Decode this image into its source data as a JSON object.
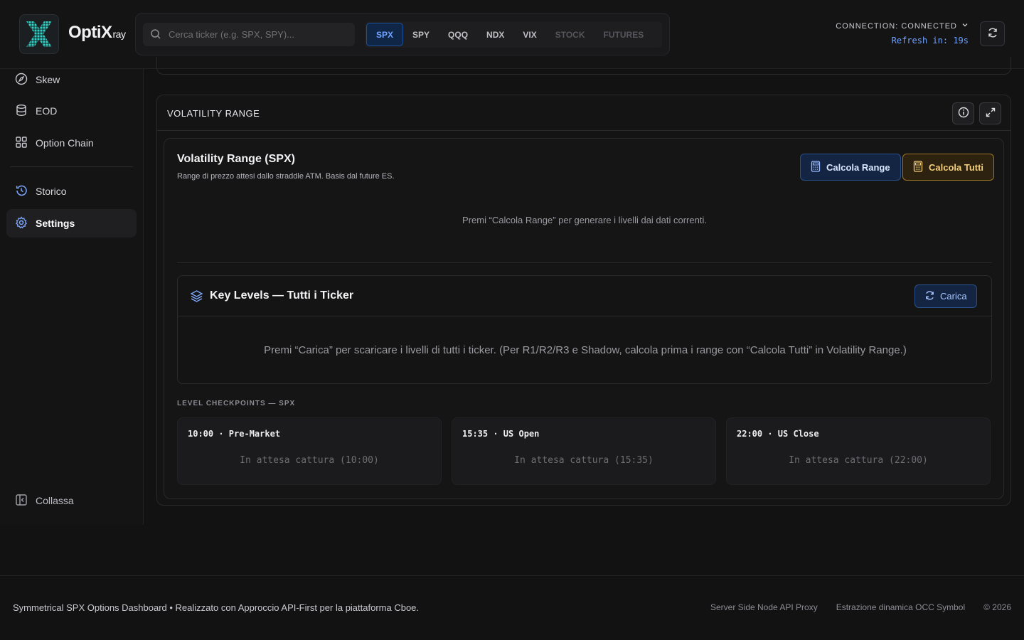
{
  "app": {
    "name": "OptiX",
    "name_suffix": "ray"
  },
  "search": {
    "placeholder": "Cerca ticker (e.g. SPX, SPY)..."
  },
  "tickers": [
    {
      "label": "SPX",
      "state": "active"
    },
    {
      "label": "SPY",
      "state": "normal"
    },
    {
      "label": "QQQ",
      "state": "normal"
    },
    {
      "label": "NDX",
      "state": "normal"
    },
    {
      "label": "VIX",
      "state": "normal"
    },
    {
      "label": "STOCK",
      "state": "muted"
    },
    {
      "label": "FUTURES",
      "state": "muted"
    }
  ],
  "connection": {
    "label": "CONNECTION: CONNECTED",
    "refresh": "Refresh in: 19s"
  },
  "sidebar": {
    "items": [
      {
        "label": "Skew"
      },
      {
        "label": "EOD"
      },
      {
        "label": "Option Chain"
      },
      {
        "label": "Storico"
      },
      {
        "label": "Settings"
      }
    ],
    "collapse_label": "Collassa"
  },
  "volatility_card": {
    "header": "VOLATILITY RANGE",
    "title": "Volatility Range (SPX)",
    "subtitle": "Range di prezzo attesi dallo straddle ATM. Basis dal future ES.",
    "btn_calc": "Calcola Range",
    "btn_calc_all": "Calcola Tutti",
    "hint": "Premi “Calcola Range” per generare i livelli dai dati correnti."
  },
  "key_levels": {
    "title": "Key Levels — Tutti i Ticker",
    "btn_load": "Carica",
    "message": "Premi “Carica” per scaricare i livelli di tutti i ticker. (Per R1/R2/R3 e Shadow, calcola prima i range con “Calcola Tutti” in Volatility Range.)"
  },
  "checkpoints": {
    "label": "LEVEL CHECKPOINTS — SPX",
    "items": [
      {
        "title": "10:00 · Pre-Market",
        "status": "In attesa cattura (10:00)"
      },
      {
        "title": "15:35 · US Open",
        "status": "In attesa cattura (15:35)"
      },
      {
        "title": "22:00 · US Close",
        "status": "In attesa cattura (22:00)"
      }
    ]
  },
  "footer": {
    "left": "Symmetrical SPX Options Dashboard • Realizzato con Approccio API-First per la piattaforma Cboe.",
    "links": [
      "Server Side Node API Proxy",
      "Estrazione dinamica OCC Symbol",
      "© 2026"
    ]
  },
  "colors": {
    "accent_blue": "#6fa3ff",
    "accent_gold": "#f3cf7b",
    "logo_teal": "#2fd3c7"
  }
}
